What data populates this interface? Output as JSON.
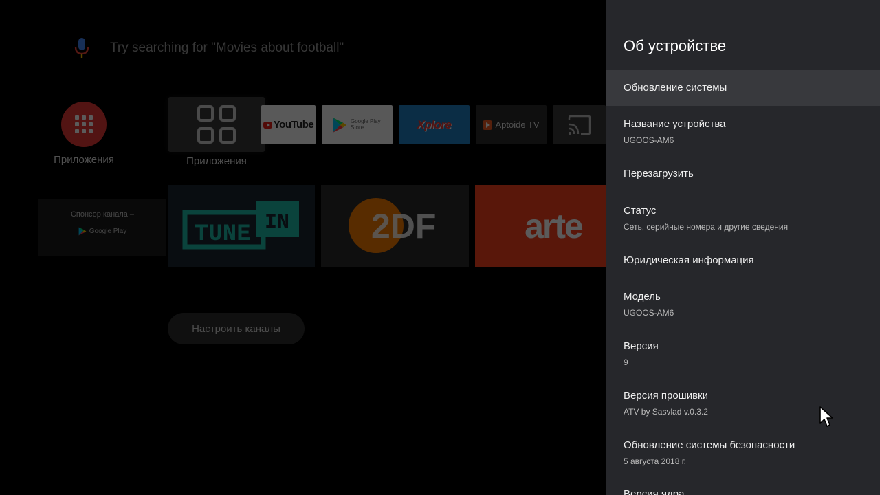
{
  "home": {
    "search_hint": "Try searching for \"Movies about football\"",
    "apps_launcher_label": "Приложения",
    "apps_tile_label": "Приложения",
    "apps": [
      {
        "name": "YouTube",
        "label": "YouTube"
      },
      {
        "name": "Google Play Store",
        "label": "Google Play Store"
      },
      {
        "name": "X-plore",
        "label": "Xplore"
      },
      {
        "name": "Aptoide TV",
        "label": "Aptoide TV"
      },
      {
        "name": "Cast",
        "icon": "cast-icon"
      }
    ],
    "sponsor_label": "Спонсор канала –",
    "sponsor_brand": "Google Play",
    "channels": [
      {
        "name": "TuneIn",
        "label": "TUNE IN"
      },
      {
        "name": "ZDF",
        "label": "2DF"
      },
      {
        "name": "arte",
        "label": "arte"
      }
    ],
    "customize_label": "Настроить каналы",
    "colors": {
      "apps_circle": "#e53935",
      "arte": "#f9411c",
      "zdf_circle": "#f57c00",
      "tunein": "#1ebca8"
    }
  },
  "settings": {
    "title": "Об устройстве",
    "items": [
      {
        "title": "Обновление системы",
        "subtitle": ""
      },
      {
        "title": "Название устройства",
        "subtitle": "UGOOS-AM6"
      },
      {
        "title": "Перезагрузить",
        "subtitle": ""
      },
      {
        "title": "Статус",
        "subtitle": "Сеть, серийные номера и другие сведения"
      },
      {
        "title": "Юридическая информация",
        "subtitle": ""
      },
      {
        "title": "Модель",
        "subtitle": "UGOOS-AM6"
      },
      {
        "title": "Версия",
        "subtitle": "9"
      },
      {
        "title": "Версия прошивки",
        "subtitle": "ATV by Sasvlad v.0.3.2"
      },
      {
        "title": "Обновление системы безопасности",
        "subtitle": "5 августа 2018 г."
      },
      {
        "title": "Версия ядра",
        "subtitle": ""
      }
    ],
    "colors": {
      "panel": "#26272b",
      "focused": "#38393d"
    }
  }
}
